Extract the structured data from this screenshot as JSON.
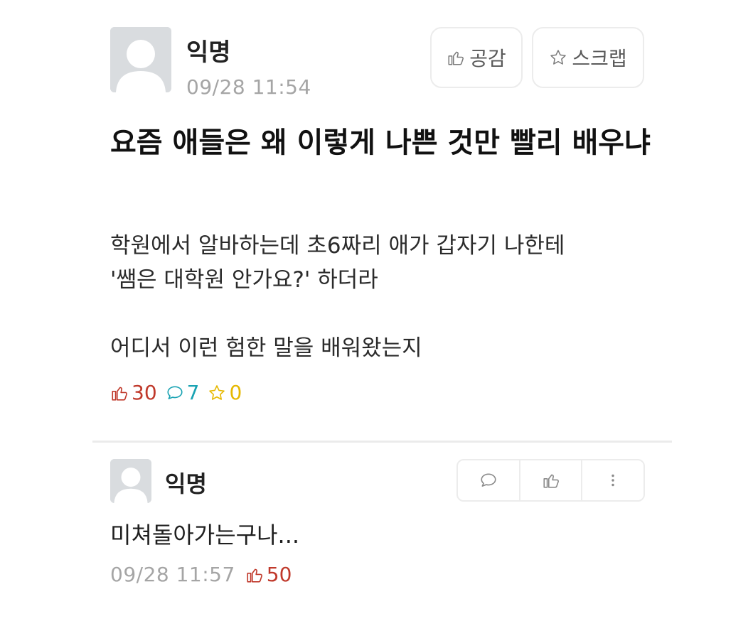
{
  "post": {
    "author": "익명",
    "time": "09/28 11:54",
    "title": "요즘 애들은 왜 이렇게 나쁜 것만 빨리 배우냐",
    "body": [
      "학원에서 알바하는데 초6짜리 애가 갑자기 나한테\n'쌤은 대학원 안가요?' 하더라",
      "어디서 이런 험한 말을 배워왔는지"
    ],
    "buttons": {
      "like_label": "공감",
      "scrap_label": "스크랩"
    },
    "stats": {
      "likes": "30",
      "comments": "7",
      "scraps": "0"
    }
  },
  "comment": {
    "author": "익명",
    "text": "미쳐돌아가는구나...",
    "time": "09/28 11:57",
    "likes": "50"
  },
  "icons": {
    "thumbs_up": "thumbs-up-icon",
    "star": "star-icon",
    "speech_bubble": "comment-icon",
    "more": "more-vertical-icon",
    "avatar": "anonymous-avatar-icon"
  },
  "colors": {
    "like_red": "#c0392b",
    "comment_teal": "#1aa3b3",
    "scrap_yellow": "#e6b800",
    "meta_gray": "#a5a5a5"
  }
}
